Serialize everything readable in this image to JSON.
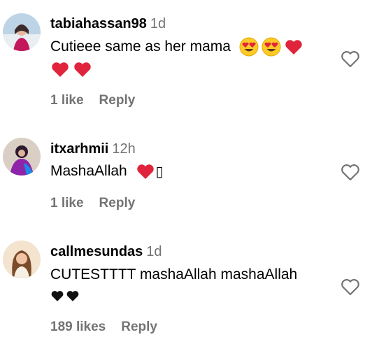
{
  "comments": [
    {
      "username": "tabiahassan98",
      "time": "1d",
      "text": "Cutieee same as her mama",
      "emoji_line1": [
        "heart-eyes-icon",
        "heart-eyes-icon",
        "red-heart-icon"
      ],
      "emoji_line2": [
        "red-heart-icon",
        "red-heart-icon"
      ],
      "likes": "1 like",
      "reply": "Reply"
    },
    {
      "username": "itxarhmii",
      "time": "12h",
      "text": "MashaAllah",
      "emoji_line1": [
        "red-heart-icon"
      ],
      "trailing_glyph": "▯",
      "likes": "1 like",
      "reply": "Reply"
    },
    {
      "username": "callmesundas",
      "time": "1d",
      "text": "CUTESTTTT mashaAllah mashaAllah",
      "emoji_line2": [
        "black-heart-icon",
        "black-heart-icon"
      ],
      "likes": "189 likes",
      "reply": "Reply"
    }
  ],
  "colors": {
    "text": "#000000",
    "secondary": "#737373",
    "heart_red": "#e0243c",
    "emoji_yellow": "#ffca28",
    "like_outline": "#737373"
  }
}
